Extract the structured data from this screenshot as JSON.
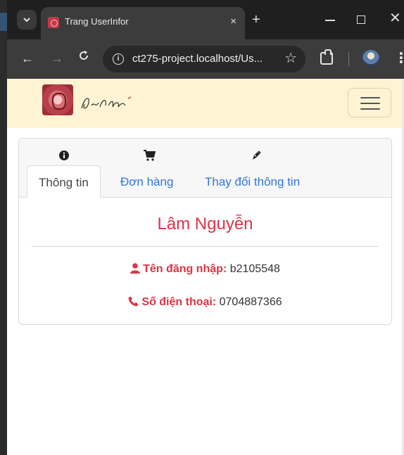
{
  "browser": {
    "tab_title": "Trang UserInfor",
    "tab_close": "×",
    "new_tab": "+",
    "window_close": "✕",
    "url": "ct275-project.localhost/Us...",
    "nav_back": "←",
    "nav_forward": "→",
    "reload": "C",
    "site_info": "i",
    "bookmark": "☆",
    "menu": "⋮"
  },
  "navbar": {
    "logo_icon": "seal-logo-icon",
    "signature": "signature-logo",
    "toggler_icon": "hamburger-icon"
  },
  "card": {
    "tabs": [
      {
        "label": "Thông tin",
        "icon": "info-circle-icon",
        "active": true
      },
      {
        "label": "Đơn hàng",
        "icon": "cart-icon",
        "active": false
      },
      {
        "label": "Thay đổi thông tin",
        "icon": "pen-icon",
        "active": false
      }
    ],
    "name": "Lâm Nguyễn",
    "username_label": "Tên đăng nhập:",
    "username_value": "b2105548",
    "phone_label": "Số điện thoại:",
    "phone_value": "0704887366"
  },
  "colors": {
    "accent": "#dc3545",
    "link": "#2f76d6",
    "navbar_bg": "#fef4d4"
  }
}
